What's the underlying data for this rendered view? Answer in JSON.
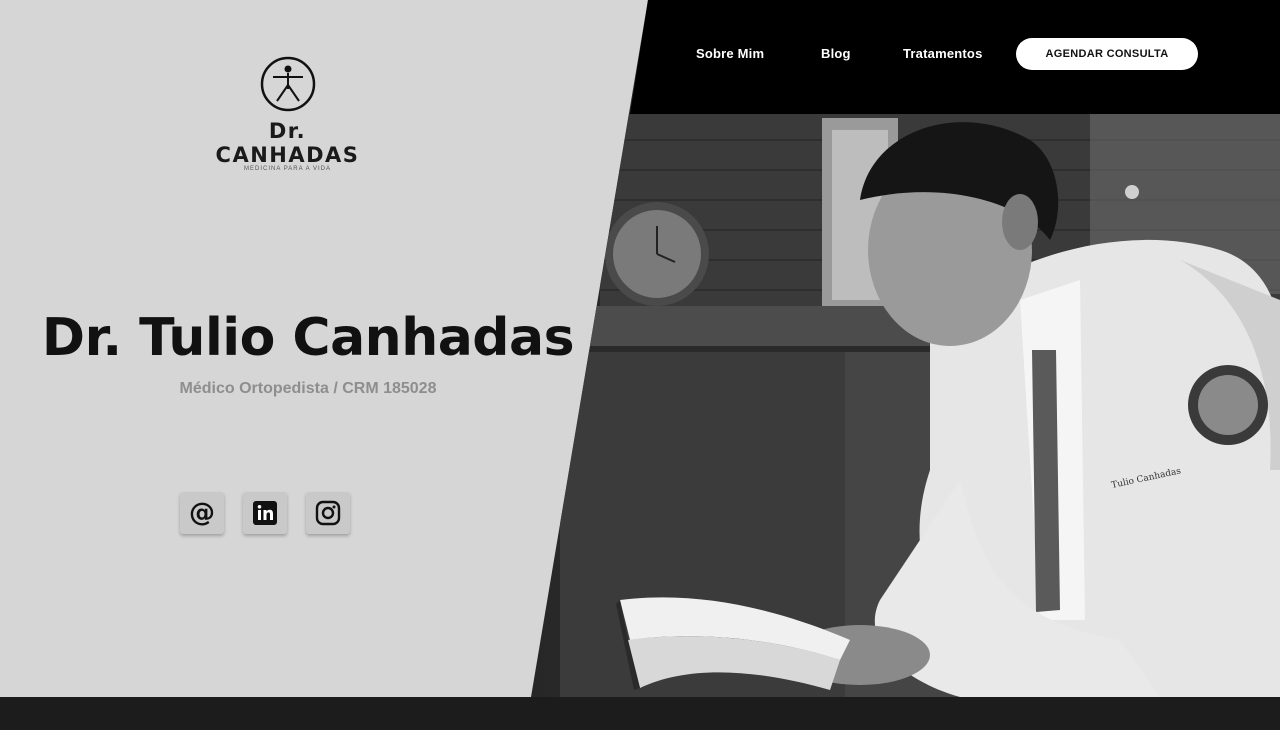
{
  "logo": {
    "wordmark": "Dr. CANHADAS",
    "tagline": "MEDICINA PARA A VIDA",
    "icon": "figure-circle-icon"
  },
  "nav": {
    "items": [
      {
        "label": "Sobre Mim"
      },
      {
        "label": "Blog"
      },
      {
        "label": "Tratamentos"
      }
    ],
    "cta_label": "AGENDAR CONSULTA"
  },
  "hero": {
    "name": "Dr. Tulio Canhadas",
    "subtitle": "Médico Ortopedista / CRM 185028"
  },
  "social": [
    {
      "icon": "email-at-icon"
    },
    {
      "icon": "linkedin-icon"
    },
    {
      "icon": "instagram-icon"
    }
  ],
  "photo": {
    "subject": "doctor-reading-book-photo"
  },
  "colors": {
    "left_background": "#d6d6d6",
    "nav_background": "#000000",
    "title_text": "#111111",
    "subtitle_text": "#8e8e8e",
    "footer": "#1c1c1c",
    "cta_background": "#ffffff"
  }
}
